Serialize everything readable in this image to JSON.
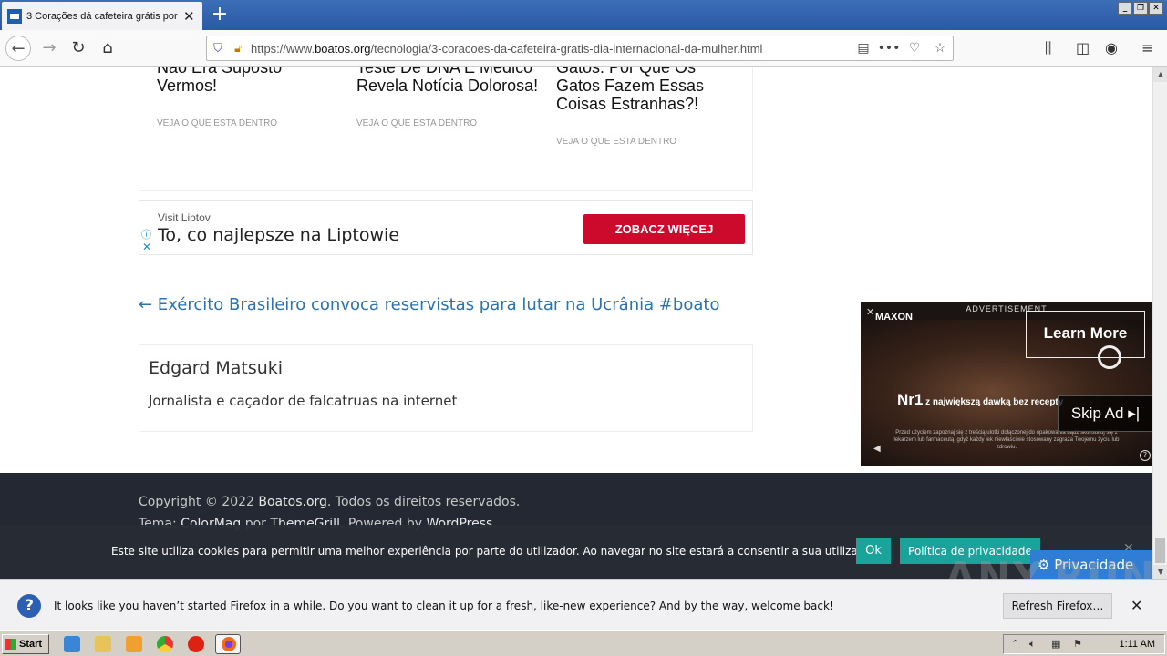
{
  "browser": {
    "tab_title": "3 Corações dá cafeteira grátis por",
    "url_prefix": "https://www.",
    "url_domain": "boatos.org",
    "url_path": "/tecnologia/3-coracoes-da-cafeteira-gratis-dia-internacional-da-mulher.html"
  },
  "related": [
    {
      "title": "Não Era Suposto Vermos!",
      "link": "VEJA O QUE ESTA DENTRO"
    },
    {
      "title": "Teste De DNA E Médico Revela Notícia Dolorosa!",
      "link": "VEJA O QUE ESTA DENTRO"
    },
    {
      "title": "Gatos: Por Que Os Gatos Fazem Essas Coisas Estranhas?!",
      "link": "VEJA O QUE ESTA DENTRO"
    }
  ],
  "banner_ad": {
    "brand": "Visit Liptov",
    "headline": "To, co najlepsze na Liptowie",
    "cta": "ZOBACZ WIĘCEJ"
  },
  "prev_post": "← Exército Brasileiro convoca reservistas para lutar na Ucrânia #boato",
  "author": {
    "name": "Edgard Matsuki",
    "bio": "Jornalista e caçador de falcatruas na internet"
  },
  "footer": {
    "copy_prefix": "Copyright © 2022 ",
    "site": "Boatos.org",
    "copy_suffix": ". Todos os direitos reservados.",
    "theme_prefix": "Tema: ",
    "theme_name": "ColorMag",
    "theme_by": " por ",
    "theme_author": "ThemeGrill",
    "powered": ". Powered by ",
    "wordpress": "WordPress",
    "dot": "."
  },
  "video_ad": {
    "label": "ADVERTISEMENT",
    "logo": "MAXON",
    "learn_more": "Learn More",
    "headline": "Nr1",
    "headline_small": " z największą dawką bez recepty",
    "fine_print": "Przed użyciem zapoznaj się z treścią ulotki dołączonej do opakowania bądź skonsultuj się z lekarzem lub farmaceutą, gdyż każdy lek niewłaściwie stosowany zagraża Twojemu życiu lub zdrowiu.",
    "skip": "Skip Ad ▸|"
  },
  "cookie": {
    "message": "Este site utiliza cookies para permitir uma melhor experiência por parte do utilizador. Ao navegar no site estará a consentir a sua utilização.",
    "ok": "Ok",
    "policy": "Política de privacidade",
    "privacy_button": "Privacidade"
  },
  "notification": {
    "text": "It looks like you haven’t started Firefox in a while. Do you want to clean it up for a fresh, like-new experience? And by the way, welcome back!",
    "button": "Refresh Firefox…"
  },
  "watermark": "ANY.RUN",
  "taskbar": {
    "start": "Start",
    "time": "1:11 AM"
  },
  "colors": {
    "link": "#2b72b0",
    "cta_red": "#cc0a2c",
    "cookie_button": "#1aa39a",
    "footer_bg": "#232832"
  }
}
